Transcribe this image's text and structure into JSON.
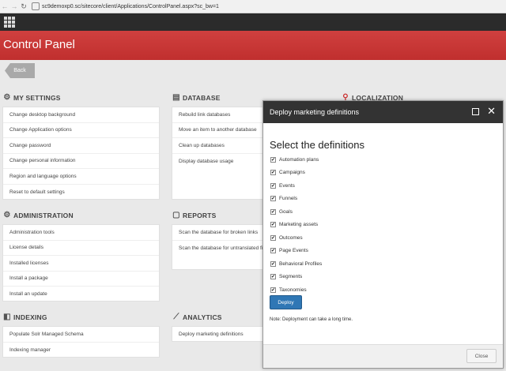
{
  "browser": {
    "url": "sc9demoxp0.sc/sitecore/client/Applications/ControlPanel.aspx?sc_bw=1"
  },
  "header": {
    "title": "Control Panel"
  },
  "back_label": "Back",
  "sections": {
    "my_settings": {
      "title": "MY SETTINGS",
      "items": [
        "Change desktop background",
        "Change Application options",
        "Change password",
        "Change personal information",
        "Region and language options",
        "Reset to default settings"
      ]
    },
    "database": {
      "title": "DATABASE",
      "items": [
        "Rebuild link databases",
        "Move an item to another database",
        "Clean up databases",
        "Display database usage"
      ]
    },
    "localization": {
      "title": "LOCALIZATION"
    },
    "administration": {
      "title": "ADMINISTRATION",
      "items": [
        "Administration tools",
        "License details",
        "Installed licenses",
        "Install a package",
        "Install an update"
      ]
    },
    "reports": {
      "title": "REPORTS",
      "items": [
        "Scan the database for broken links",
        "Scan the database for untranslated fi"
      ]
    },
    "indexing": {
      "title": "INDEXING",
      "items": [
        "Populate Solr Managed Schema",
        "Indexing manager"
      ]
    },
    "analytics": {
      "title": "ANALYTICS",
      "items": [
        "Deploy marketing definitions"
      ]
    }
  },
  "modal": {
    "title": "Deploy marketing definitions",
    "subtitle": "Select the definitions",
    "options": [
      {
        "label": "Automation plans",
        "checked": true
      },
      {
        "label": "Campaigns",
        "checked": true
      },
      {
        "label": "Events",
        "checked": true
      },
      {
        "label": "Funnels",
        "checked": true
      },
      {
        "label": "Goals",
        "checked": true
      },
      {
        "label": "Marketing assets",
        "checked": true
      },
      {
        "label": "Outcomes",
        "checked": true
      },
      {
        "label": "Page Events",
        "checked": true
      },
      {
        "label": "Behavioral Profiles",
        "checked": true
      },
      {
        "label": "Segments",
        "checked": true
      },
      {
        "label": "Taxonomies",
        "checked": true
      }
    ],
    "deploy_label": "Deploy",
    "note": "Note: Deployment can take a long time.",
    "close_label": "Close"
  },
  "colors": {
    "header_red": "#c8393a",
    "deploy_blue": "#2f77b5",
    "topbar": "#2b2b2b"
  }
}
